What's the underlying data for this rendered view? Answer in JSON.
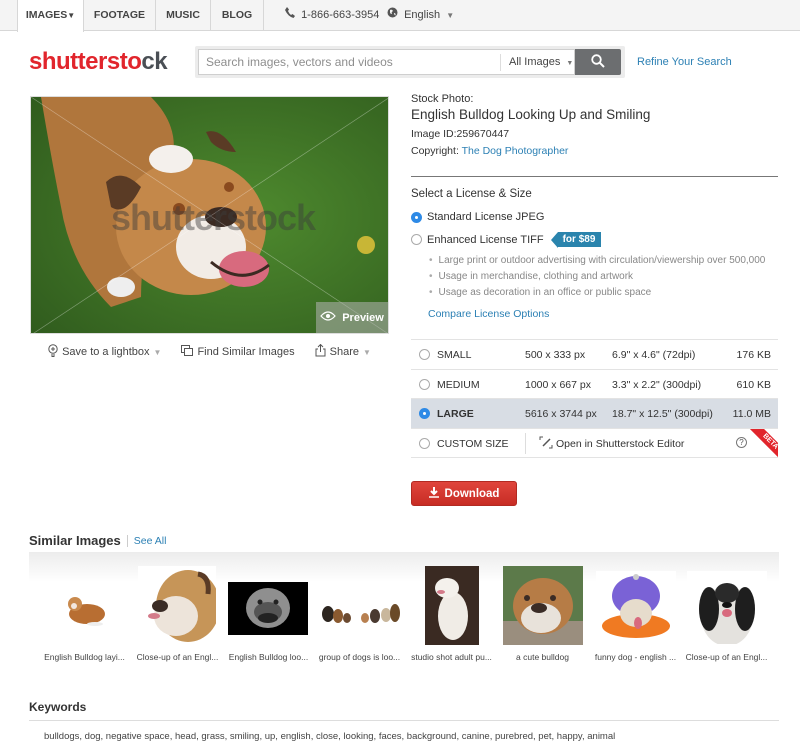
{
  "nav": {
    "tabs": [
      {
        "label": "IMAGES",
        "active": true,
        "has_caret": true
      },
      {
        "label": "FOOTAGE",
        "active": false
      },
      {
        "label": "MUSIC",
        "active": false
      },
      {
        "label": "BLOG",
        "active": false
      }
    ],
    "phone": "1-866-663-3954",
    "language": "English",
    "caret": "▼"
  },
  "header": {
    "logo_red": "shutterst",
    "logo_mid": "o",
    "logo_grey": "ck",
    "search_placeholder": "Search images, vectors and videos",
    "search_value": "",
    "category": "All Images",
    "refine_link": "Refine Your Search"
  },
  "photo": {
    "watermark": "shutterstock",
    "preview_label": "Preview",
    "actions": [
      {
        "label": "Save to a lightbox",
        "icon": "lightbulb-icon",
        "caret": true
      },
      {
        "label": "Find Similar Images",
        "icon": "similar-icon",
        "caret": false
      },
      {
        "label": "Share",
        "icon": "share-icon",
        "caret": true
      }
    ]
  },
  "info": {
    "label": "Stock Photo:",
    "title": "English Bulldog Looking Up and Smiling",
    "image_id_label": "Image ID:",
    "image_id": "259670447",
    "copyright_label": "Copyright: ",
    "copyright_holder": "The Dog Photographer"
  },
  "license": {
    "heading": "Select a License & Size",
    "options": [
      {
        "label": "Standard License JPEG",
        "selected": true
      },
      {
        "label": "Enhanced License TIFF",
        "selected": false,
        "price": "for $89"
      }
    ],
    "enhanced_bullets": [
      "Large print or outdoor advertising with circulation/viewership over 500,000",
      "Usage in merchandise, clothing and artwork",
      "Usage as decoration in an office or public space"
    ],
    "compare_link": "Compare License Options"
  },
  "sizes": [
    {
      "name": "SMALL",
      "pixels": "500 x 333 px",
      "inches": "6.9\" x 4.6\" (72dpi)",
      "filesize": "176 KB",
      "selected": false
    },
    {
      "name": "MEDIUM",
      "pixels": "1000 x 667 px",
      "inches": "3.3\" x 2.2\" (300dpi)",
      "filesize": "610 KB",
      "selected": false
    },
    {
      "name": "LARGE",
      "pixels": "5616 x 3744 px",
      "inches": "18.7\" x 12.5\" (300dpi)",
      "filesize": "11.0 MB",
      "selected": true
    }
  ],
  "custom_size": {
    "name": "CUSTOM SIZE",
    "editor_label": "Open in Shutterstock Editor",
    "help": "?",
    "badge": "BETA"
  },
  "download_label": "Download",
  "similar": {
    "heading": "Similar Images",
    "see_all": "See All",
    "items": [
      {
        "caption": "English Bulldog layi..."
      },
      {
        "caption": "Close-up of an Engl..."
      },
      {
        "caption": "English Bulldog loo..."
      },
      {
        "caption": "group of dogs is loo..."
      },
      {
        "caption": "studio shot adult pu..."
      },
      {
        "caption": "a cute bulldog"
      },
      {
        "caption": "funny dog - english ..."
      },
      {
        "caption": "Close-up of an Engl..."
      }
    ]
  },
  "keywords": {
    "heading": "Keywords",
    "list": "bulldogs, dog, negative space, head, grass, smiling, up, english, close, looking, faces, background, canine, purebred, pet, happy, animal"
  },
  "colors": {
    "brand_red": "#e1252c",
    "link_blue": "#2c80b4",
    "radio_blue": "#2e8ae6",
    "price_tag": "#2a84ad",
    "selected_row": "#d8dde4"
  }
}
